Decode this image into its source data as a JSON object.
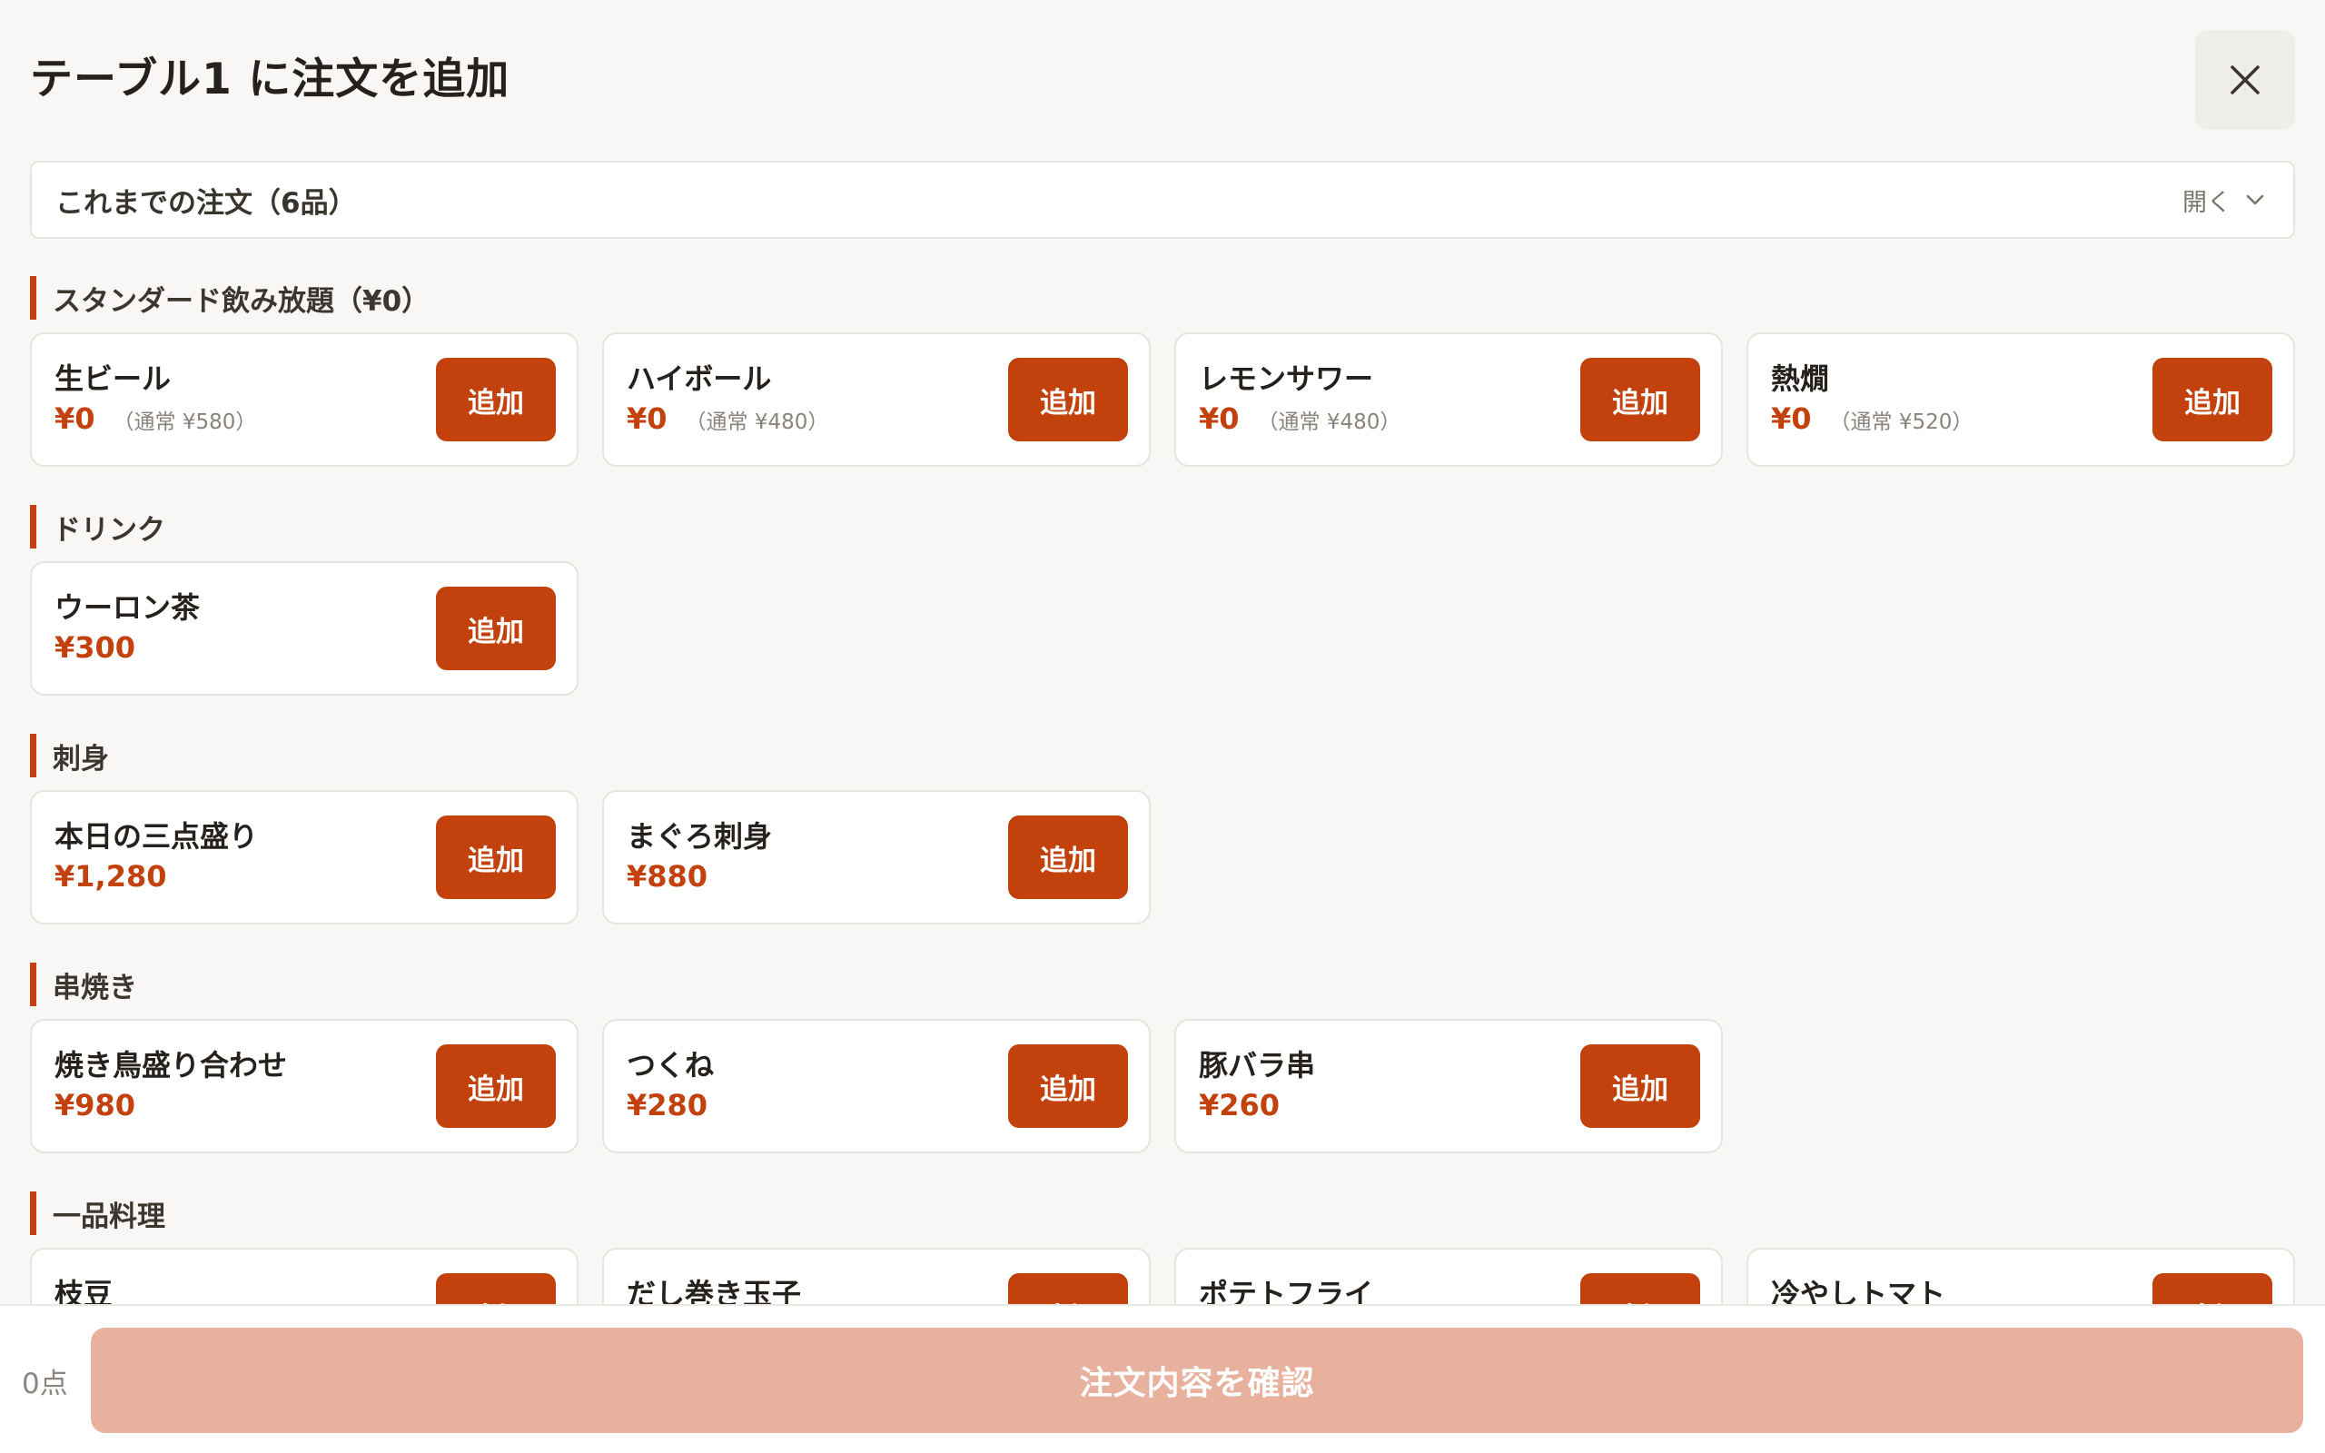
{
  "header": {
    "title": "テーブル1 に注文を追加",
    "close_icon": "close-icon"
  },
  "past_orders": {
    "label": "これまでの注文（6品）",
    "toggle_label": "開く",
    "toggle_icon": "chevron-down-icon"
  },
  "accent_color": "#c2410c",
  "sections": [
    {
      "title": "スタンダード飲み放題（¥0）",
      "items": [
        {
          "name": "生ビール",
          "price": "¥0",
          "regular": "（通常 ¥580）",
          "button": "追加"
        },
        {
          "name": "ハイボール",
          "price": "¥0",
          "regular": "（通常 ¥480）",
          "button": "追加"
        },
        {
          "name": "レモンサワー",
          "price": "¥0",
          "regular": "（通常 ¥480）",
          "button": "追加"
        },
        {
          "name": "熱燗",
          "price": "¥0",
          "regular": "（通常 ¥520）",
          "button": "追加"
        }
      ]
    },
    {
      "title": "ドリンク",
      "items": [
        {
          "name": "ウーロン茶",
          "price": "¥300",
          "button": "追加"
        }
      ]
    },
    {
      "title": "刺身",
      "items": [
        {
          "name": "本日の三点盛り",
          "price": "¥1,280",
          "button": "追加"
        },
        {
          "name": "まぐろ刺身",
          "price": "¥880",
          "button": "追加"
        }
      ]
    },
    {
      "title": "串焼き",
      "items": [
        {
          "name": "焼き鳥盛り合わせ",
          "price": "¥980",
          "button": "追加"
        },
        {
          "name": "つくね",
          "price": "¥280",
          "button": "追加"
        },
        {
          "name": "豚バラ串",
          "price": "¥260",
          "button": "追加"
        }
      ]
    },
    {
      "title": "一品料理",
      "items": [
        {
          "name": "枝豆",
          "button": "追加"
        },
        {
          "name": "だし巻き玉子",
          "button": "追加"
        },
        {
          "name": "ポテトフライ",
          "button": "追加"
        },
        {
          "name": "冷やしトマト",
          "button": "追加"
        }
      ]
    }
  ],
  "footer": {
    "count": "0点",
    "confirm_label": "注文内容を確認"
  }
}
